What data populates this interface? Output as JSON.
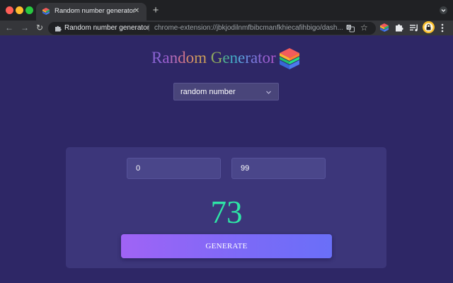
{
  "browser": {
    "tab": {
      "title": "Random number generator",
      "close": "✕"
    },
    "new_tab": "+",
    "nav": {
      "back": "←",
      "forward": "→",
      "reload": "↻"
    },
    "omnibox": {
      "site": "Random number generator",
      "separator": "|",
      "url": "chrome-extension://jbkjodilnmfbibcmanfkhiecafihbigo/dash..."
    },
    "star": "☆"
  },
  "app": {
    "title": "Random Generator",
    "title_letter_colors": [
      "#8a63d2",
      "#9c5fcf",
      "#b36bb8",
      "#c9718f",
      "#d48a6a",
      "#c89b5a",
      "#a6a857",
      "#8ea95f",
      "#4fae93",
      "#43a9c3",
      "#5a9fd8",
      "#6a8be0",
      "#7a79dc",
      "#8b69d4",
      "#9a5fcf",
      "#a858c9"
    ],
    "type_select": {
      "value": "random number"
    },
    "min_input": {
      "value": "0"
    },
    "max_input": {
      "value": "99"
    },
    "result": "73",
    "generate_label": "GENERATE"
  },
  "icons": {
    "tab_favicon": "stacked-cubes-icon",
    "omnibox_site": "puzzle-piece-icon",
    "translate": "translate-icon",
    "bookmark": "star-icon",
    "extension": "stacked-cubes-icon",
    "extensions_menu": "puzzle-piece-icon",
    "reading_list": "queue-list-icon",
    "profile": "lock-avatar-icon",
    "menu": "kebab-menu-icon"
  },
  "colors": {
    "page_background": "#2e2766",
    "card_background": "#3c367a",
    "result_color": "#2ee6a6",
    "button_gradient_start": "#a063f5",
    "button_gradient_end": "#6a6ff8"
  }
}
